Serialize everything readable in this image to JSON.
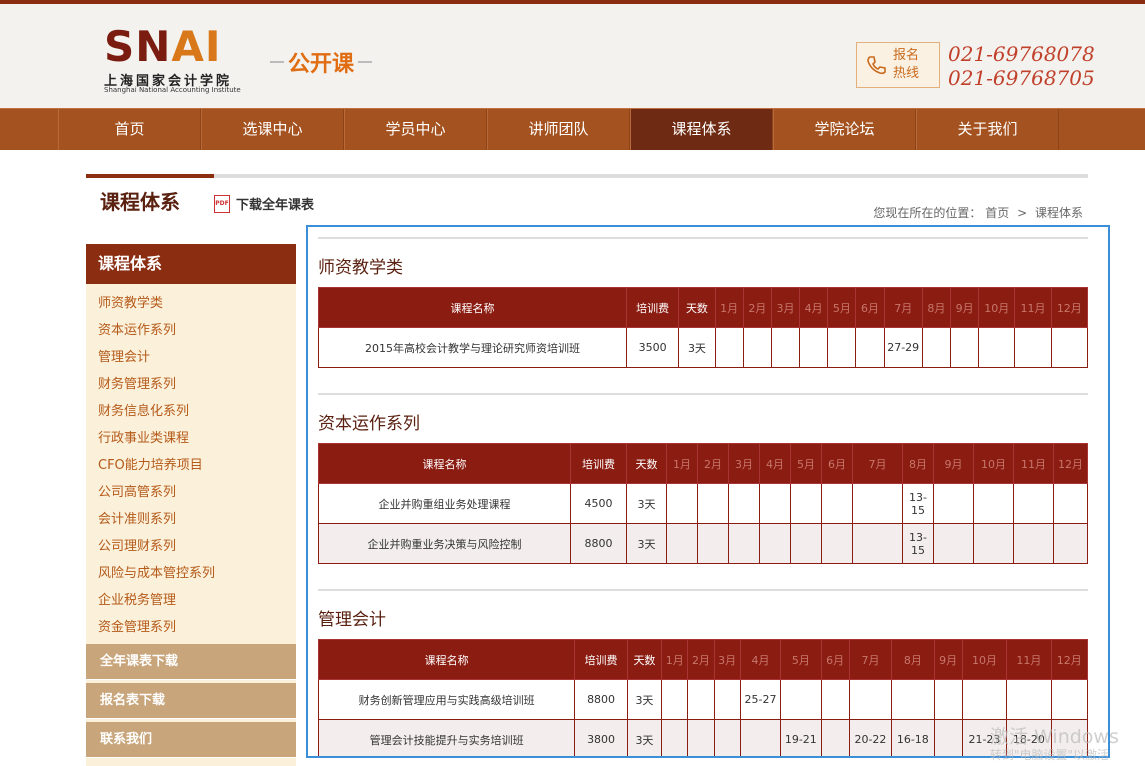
{
  "header": {
    "logo_text_sn": "SN",
    "logo_text_ai": "AI",
    "logo_cn": "上海国家会计学院",
    "logo_en": "Shanghai National Accounting Institute",
    "section_name": "公开课",
    "hotline_label": "报名热线",
    "phones": [
      "021-69768078",
      "021-69768705"
    ]
  },
  "nav": {
    "items": [
      "首页",
      "选课中心",
      "学员中心",
      "讲师团队",
      "课程体系",
      "学院论坛",
      "关于我们"
    ],
    "active_index": 4
  },
  "page": {
    "title": "课程体系",
    "download_label": "下载全年课表",
    "pdf_icon_text": "PDF",
    "breadcrumb_prefix": "您现在所在的位置：",
    "breadcrumb_home": "首页",
    "breadcrumb_sep": ">",
    "breadcrumb_current": "课程体系"
  },
  "sidebar": {
    "title": "课程体系",
    "items": [
      "师资教学类",
      "资本运作系列",
      "管理会计",
      "财务管理系列",
      "财务信息化系列",
      "行政事业类课程",
      "CFO能力培养项目",
      "公司高管系列",
      "会计准则系列",
      "公司理财系列",
      "风险与成本管控系列",
      "企业税务管理",
      "资金管理系列"
    ],
    "buttons": [
      "全年课表下载",
      "报名表下载",
      "联系我们"
    ]
  },
  "table_headers": {
    "name": "课程名称",
    "fee": "培训费",
    "days": "天数",
    "months": [
      "1月",
      "2月",
      "3月",
      "4月",
      "5月",
      "6月",
      "7月",
      "8月",
      "9月",
      "10月",
      "11月",
      "12月"
    ]
  },
  "sections": [
    {
      "title": "师资教学类",
      "rows": [
        {
          "name": "2015年高校会计教学与理论研究师资培训班",
          "fee": "3500",
          "days": "3天",
          "months": [
            "",
            "",
            "",
            "",
            "",
            "",
            "27-29",
            "",
            "",
            "",
            "",
            ""
          ]
        }
      ]
    },
    {
      "title": "资本运作系列",
      "rows": [
        {
          "name": "企业并购重组业务处理课程",
          "fee": "4500",
          "days": "3天",
          "months": [
            "",
            "",
            "",
            "",
            "",
            "",
            "",
            "13-15",
            "",
            "",
            "",
            ""
          ]
        },
        {
          "name": "企业并购重业务决策与风险控制",
          "fee": "8800",
          "days": "3天",
          "months": [
            "",
            "",
            "",
            "",
            "",
            "",
            "",
            "13-15",
            "",
            "",
            "",
            ""
          ]
        }
      ]
    },
    {
      "title": "管理会计",
      "rows": [
        {
          "name": "财务创新管理应用与实践高级培训班",
          "fee": "8800",
          "days": "3天",
          "months": [
            "",
            "",
            "",
            "25-27",
            "",
            "",
            "",
            "",
            "",
            "",
            "",
            ""
          ]
        },
        {
          "name": "管理会计技能提升与实务培训班",
          "fee": "3800",
          "days": "3天",
          "months": [
            "",
            "",
            "",
            "",
            "19-21",
            "",
            "20-22",
            "16-18",
            "",
            "21-23",
            "18-20",
            ""
          ]
        }
      ]
    }
  ],
  "watermark": {
    "line1": "激活 Windows",
    "line2": "转到\"电脑设置\"以激活"
  }
}
